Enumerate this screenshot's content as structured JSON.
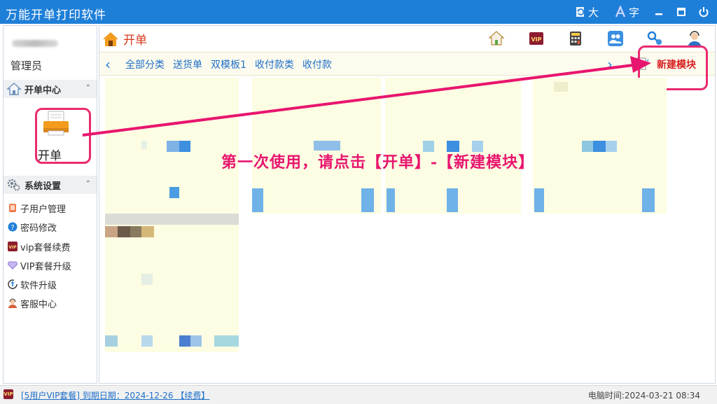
{
  "titlebar": {
    "app_title": "万能开单打印软件",
    "font_big_label": "大",
    "font_char_label": "字"
  },
  "sidebar": {
    "role": "管理员",
    "section_kaidan": "开单中心",
    "kaidan_label": "开单",
    "section_settings": "系统设置",
    "items": [
      {
        "label": "子用户管理",
        "icon": "tablet-icon"
      },
      {
        "label": "密码修改",
        "icon": "question-icon"
      },
      {
        "label": "vip套餐续费",
        "icon": "vip-icon"
      },
      {
        "label": "VIP套餐升级",
        "icon": "diamond-icon"
      },
      {
        "label": "软件升级",
        "icon": "upgrade-icon"
      },
      {
        "label": "客服中心",
        "icon": "support-icon"
      }
    ]
  },
  "main": {
    "page_title": "开单",
    "tabs": [
      "全部分类",
      "送货单",
      "双模板1",
      "收付款类",
      "收付款"
    ],
    "new_module": "新建模块"
  },
  "annotation": "第一次使用，请点击【开单】-【新建模块】",
  "status": {
    "vip_badge": "VIP",
    "vip_text": "[5用户VIP套餐] 到期日期：2024-12-26 【续费】",
    "clock": "电脑时间:2024-03-21 08:34"
  },
  "colors": {
    "titlebar": "#1e7fd8",
    "highlight": "#ea2a6f",
    "card": "#fdfde3"
  }
}
